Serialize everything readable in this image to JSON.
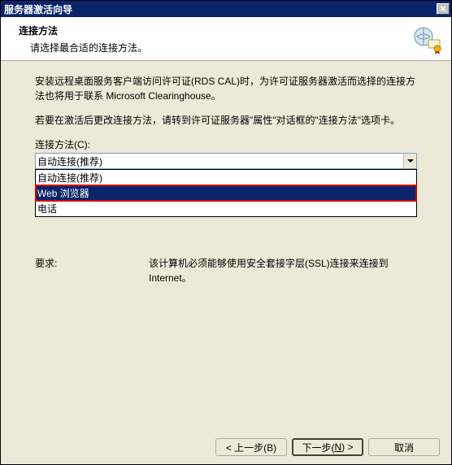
{
  "window": {
    "title": "服务器激活向导"
  },
  "header": {
    "title": "连接方法",
    "subtitle": "请选择最合适的连接方法。"
  },
  "body": {
    "para1": "安装远程桌面服务客户端访问许可证(RDS CAL)时，为许可证服务器激活而选择的连接方法也将用于联系 Microsoft Clearinghouse。",
    "para2": "若要在激活后更改连接方法，请转到许可证服务器\"属性\"对话框的\"连接方法\"选项卡。",
    "combo_label": "连接方法(C):",
    "combo_value": "自动连接(推荐)",
    "options": [
      "自动连接(推荐)",
      "Web 浏览器",
      "电话"
    ],
    "req_label": "要求:",
    "req_text": "该计算机必须能够使用安全套接字层(SSL)连接来连接到 Internet。"
  },
  "footer": {
    "back": "< 上一步(B)",
    "next_prefix": "下一步(",
    "next_key": "N",
    "next_suffix": ") >",
    "cancel": "取消"
  }
}
